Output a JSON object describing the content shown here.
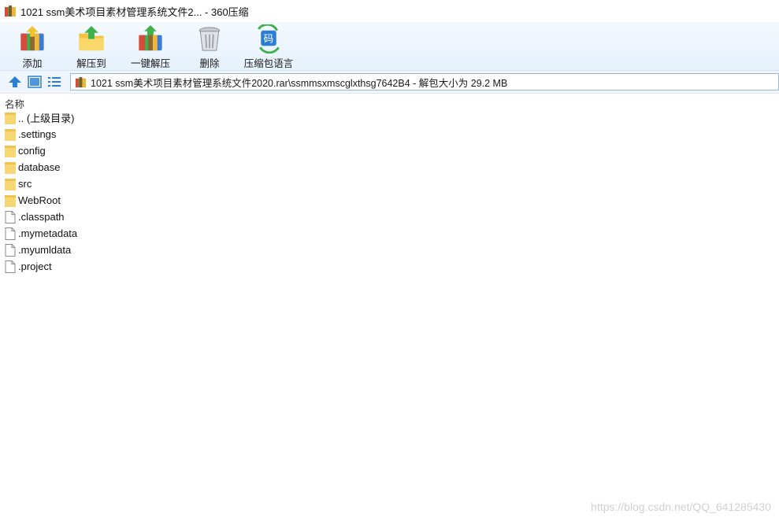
{
  "window": {
    "title": "1021 ssm美术项目素材管理系统文件2... - 360压缩",
    "app_icon": "archive-icon"
  },
  "toolbar": {
    "items": [
      {
        "label": "添加",
        "icon": "add-books-icon"
      },
      {
        "label": "解压到",
        "icon": "extract-folder-icon"
      },
      {
        "label": "一键解压",
        "icon": "one-click-extract-icon"
      },
      {
        "label": "删除",
        "icon": "trash-can-icon"
      },
      {
        "label": "压缩包语言",
        "icon": "archive-language-icon"
      },
      {
        "label": "码",
        "icon": "language-glyph"
      }
    ]
  },
  "navbar": {
    "up_icon": "up-arrow-icon",
    "thumbnail_icon": "thumbnail-view-icon",
    "list_icon": "list-view-icon",
    "address": "1021 ssm美术项目素材管理系统文件2020.rar\\ssmmsxmscglxthsg7642B4 - 解包大小为 29.2 MB"
  },
  "columns": {
    "name": "名称"
  },
  "files": [
    {
      "name": ".. (上级目录)",
      "type": "folder"
    },
    {
      "name": ".settings",
      "type": "folder"
    },
    {
      "name": "config",
      "type": "folder"
    },
    {
      "name": "database",
      "type": "folder"
    },
    {
      "name": "src",
      "type": "folder"
    },
    {
      "name": "WebRoot",
      "type": "folder"
    },
    {
      "name": ".classpath",
      "type": "file"
    },
    {
      "name": ".mymetadata",
      "type": "file"
    },
    {
      "name": ".myumldata",
      "type": "file"
    },
    {
      "name": ".project",
      "type": "file"
    }
  ],
  "watermark": "https://blog.csdn.net/QQ_641285430",
  "colors": {
    "toolbar_bg": "#e6f1fb",
    "accent": "#2a7fd4",
    "folder": "#f7d774"
  }
}
